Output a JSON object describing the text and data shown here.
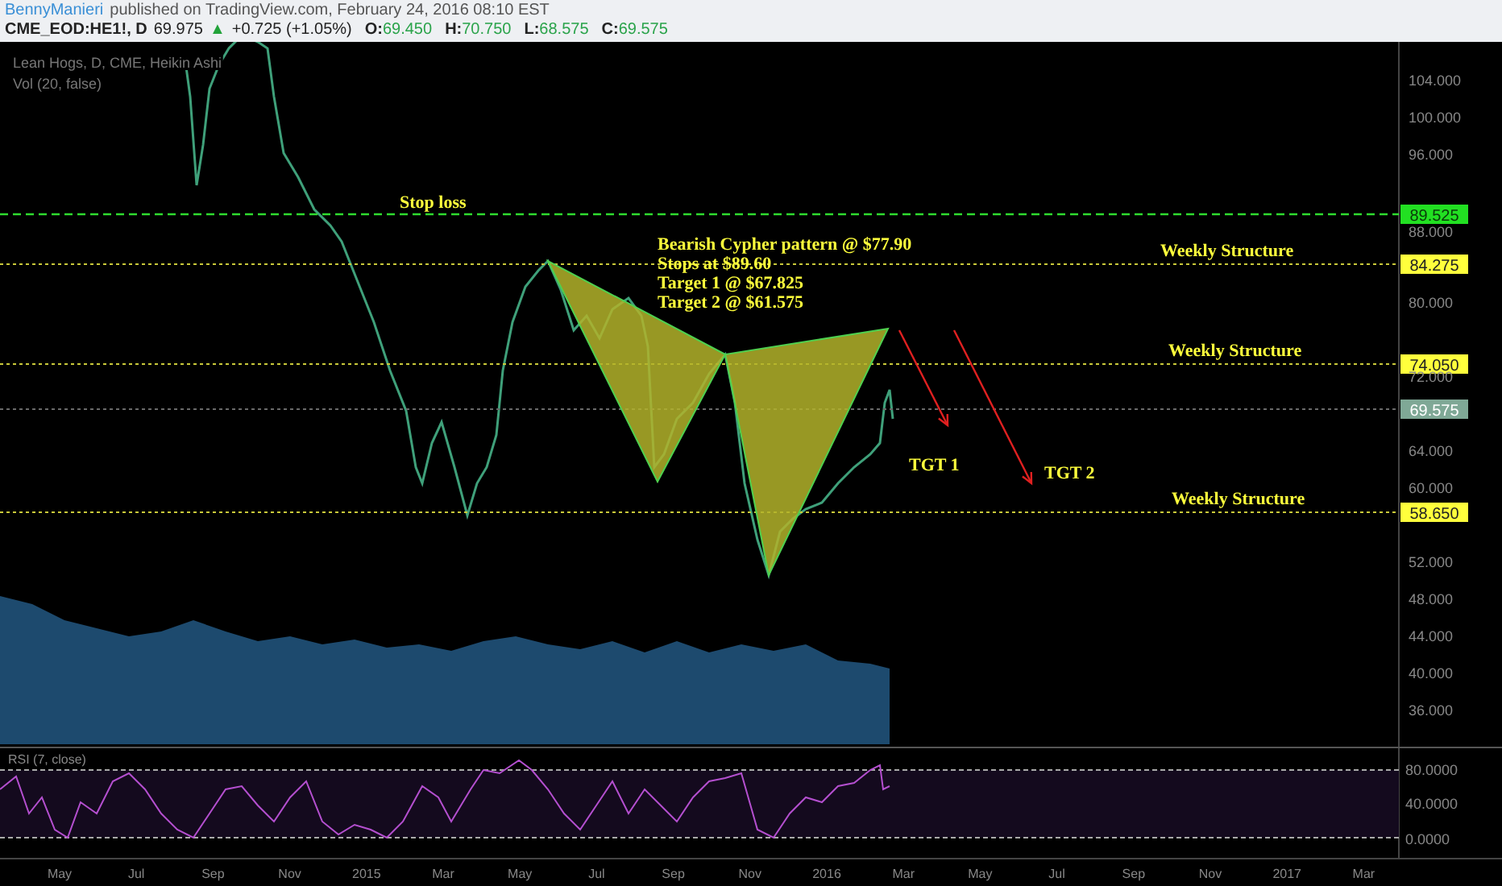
{
  "header": {
    "author": "BennyManieri",
    "published": "published on TradingView.com, February 24, 2016 08:10 EST"
  },
  "quote": {
    "symbol": "CME_EOD:HE1!, D",
    "last": "69.975",
    "arrow": "▲",
    "change": "+0.725 (+1.05%)",
    "ohlc": [
      {
        "label": "O:",
        "value": "69.450"
      },
      {
        "label": "H:",
        "value": "70.750"
      },
      {
        "label": "L:",
        "value": "68.575"
      },
      {
        "label": "C:",
        "value": "69.575"
      }
    ]
  },
  "legend": [
    "Lean Hogs, D, CME, Heikin Ashi",
    "Vol (20, false)"
  ],
  "price_axis": [
    "104.000",
    "100.000",
    "96.000",
    "88.000",
    "80.000",
    "72.000",
    "64.000",
    "60.000",
    "52.000",
    "48.000",
    "44.000",
    "40.000",
    "36.000"
  ],
  "levels": [
    {
      "kind": "stop",
      "tag": "89.525"
    },
    {
      "kind": "structure",
      "tag": "84.275"
    },
    {
      "kind": "structure",
      "tag": "74.050"
    },
    {
      "kind": "last",
      "tag": "69.575"
    },
    {
      "kind": "structure",
      "tag": "58.650"
    }
  ],
  "annotations": [
    "Stop loss",
    "Weekly Structure",
    "Weekly Structure",
    "Weekly Structure",
    "TGT 1",
    "TGT 2"
  ],
  "pattern_note": [
    "Bearish Cypher pattern @ $77.90",
    "Stops at $89.60",
    "Target 1 @ $67.825",
    "Target 2 @ $61.575"
  ],
  "rsi": {
    "label": "RSI (7, close)",
    "axis": [
      "80.0000",
      "40.0000",
      "0.0000"
    ]
  },
  "time_axis": [
    "May",
    "Jul",
    "Sep",
    "Nov",
    "2015",
    "Mar",
    "May",
    "Jul",
    "Sep",
    "Nov",
    "2016",
    "Mar",
    "May",
    "Jul",
    "Sep",
    "Nov",
    "2017",
    "Mar"
  ]
}
